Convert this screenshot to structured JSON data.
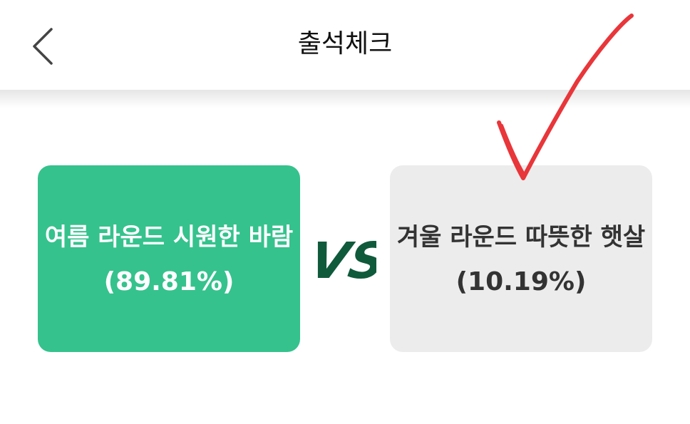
{
  "header": {
    "title": "출석체크",
    "back_icon": "chevron-left-icon"
  },
  "options": [
    {
      "title": "여름 라운드 시원한 바람",
      "percent": "(89.81%)",
      "color": "#35c28d",
      "share": 0.8981
    },
    {
      "title": "겨울 라운드 따뜻한 햇살",
      "percent": "(10.19%)",
      "color": "#ececec",
      "share": 0.1019
    }
  ],
  "vs": {
    "label": "VS",
    "color": "#0f5a3b"
  },
  "annotation": {
    "icon": "checkmark-icon",
    "color": "#e8363a"
  }
}
